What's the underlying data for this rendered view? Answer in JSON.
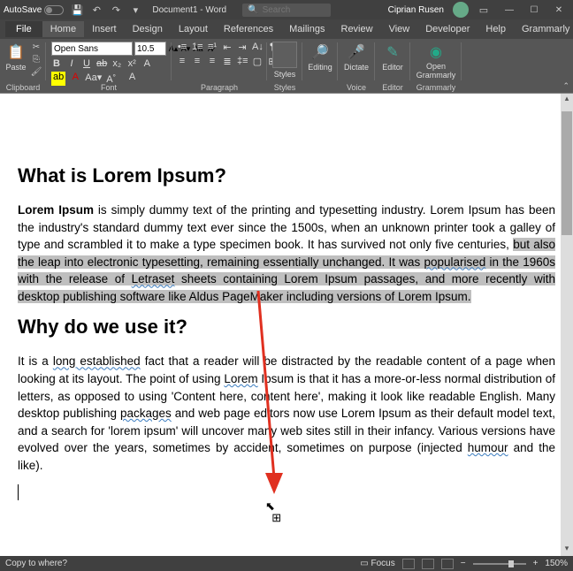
{
  "titlebar": {
    "autosave": "AutoSave",
    "doc": "Document1 - Word",
    "search_ph": "Search",
    "user": "Ciprian Rusen"
  },
  "tabs": {
    "file": "File",
    "home": "Home",
    "insert": "Insert",
    "design": "Design",
    "layout": "Layout",
    "references": "References",
    "mailings": "Mailings",
    "review": "Review",
    "view": "View",
    "developer": "Developer",
    "help": "Help",
    "grammarly": "Grammarly"
  },
  "ribbon": {
    "paste": "Paste",
    "font_name": "Open Sans",
    "font_size": "10.5",
    "clipboard": "Clipboard",
    "font": "Font",
    "paragraph": "Paragraph",
    "styles": "Styles",
    "editing": "Editing",
    "dictate": "Dictate",
    "editor": "Editor",
    "open_grammarly": "Open Grammarly",
    "voice": "Voice",
    "editor_g": "Editor",
    "grammarly_g": "Grammarly"
  },
  "doc": {
    "h1": "What is Lorem Ipsum?",
    "p1_lead": "Lorem Ipsum",
    "p1_a": " is simply dummy text of the printing and typesetting industry. Lorem Ipsum has been the industry's standard dummy text ever since the 1500s, when an unknown printer took a galley of type and scrambled it to make a type specimen book. It has survived not only five centuries, ",
    "p1_hl1": "but also the leap into electronic typesetting, remaining essentially unchanged. It was ",
    "p1_pop": "popularised",
    "p1_hl2": " in the 1960s with the release of ",
    "p1_let": "Letraset",
    "p1_hl3": " sheets containing Lorem Ipsum passages, and more recently with desktop publishing software like Aldus PageMaker including versions of Lorem Ipsum.",
    "h2": "Why do we use it?",
    "p2_a": "It is a ",
    "p2_long": "long established",
    "p2_b": " fact that a reader will be distracted by the readable content of a page when looking at its layout. The point of using ",
    "p2_lorem": "Lorem",
    "p2_c": " Ipsum is that it has a more-or-less normal distribution of letters, as opposed to using 'Content here, content here', making it look like readable English. Many desktop publishing ",
    "p2_pack": "packages",
    "p2_d": " and web page editors now use Lorem Ipsum as their default model text, and a search for 'lorem ipsum' will uncover many web sites still in their infancy. Various versions have evolved over the years, sometimes by accident, sometimes on purpose (injected ",
    "p2_hum": "humour",
    "p2_e": " and the like)."
  },
  "status": {
    "msg": "Copy to where?",
    "focus": "Focus",
    "zoom": "150%"
  }
}
